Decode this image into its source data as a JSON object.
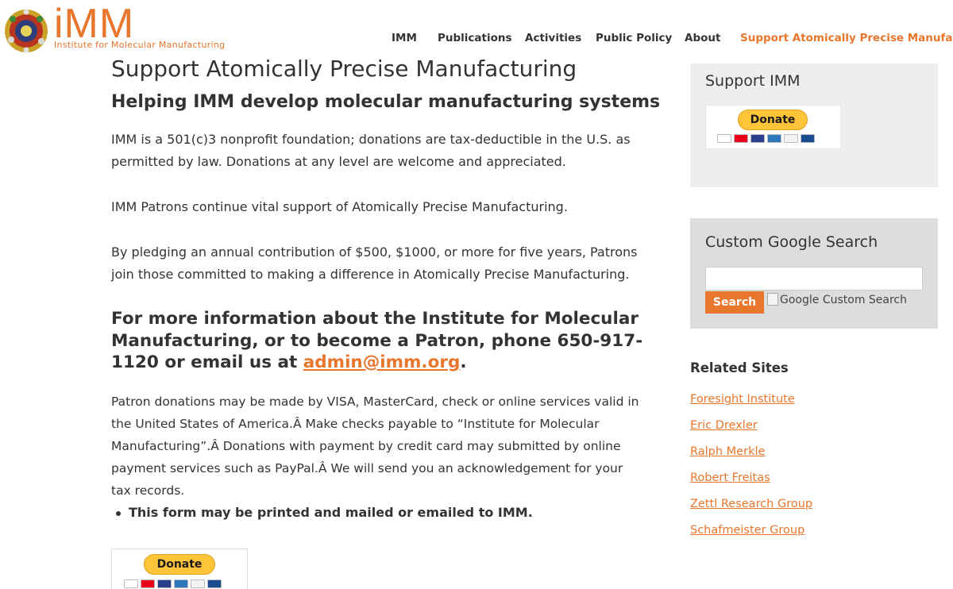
{
  "header": {
    "logo_text": "iMM",
    "logo_sub": "Institute for Molecular Manufacturing"
  },
  "nav": [
    {
      "label": "IMM",
      "active": false
    },
    {
      "label": "Publications",
      "active": false
    },
    {
      "label": "Activities",
      "active": false
    },
    {
      "label": "Public Policy",
      "active": false
    },
    {
      "label": "About",
      "active": false
    },
    {
      "label": "Support Atomically Precise Manufacturing",
      "active": true
    }
  ],
  "main": {
    "title": "Support Atomically Precise Manufacturing",
    "subtitle": "Helping IMM develop molecular manufacturing systems",
    "p1": "IMM is a 501(c)3 nonprofit foundation; donations are tax-deductible in the U.S. as permitted by law. Donations at any level are welcome and appreciated.",
    "p2": "IMM Patrons continue vital support of Atomically Precise Manufacturing.",
    "p3": "By pledging an annual contribution of $500, $1000, or more for five years, Patrons join those committed to making a difference in Atomically Precise Manufacturing.",
    "contact_heading": "For more information about the Institute for Molecular Manufacturing, or to become a Patron, phone 650-917-1120 or email us at ",
    "contact_email": "admin@imm.org",
    "contact_end": ".",
    "p4": "Patron donations may be made by VISA, MasterCard, check or online services valid in the United States of America.Â  Make checks payable to “Institute for Molecular Manufacturing”.Â Donations with payment by credit card may submitted by online payment services such as PayPal.Â  We will send you an acknowledgement for your tax records.",
    "bullet": "This form may be printed and mailed or emailed to IMM.",
    "donate_label": "Donate"
  },
  "sidebar": {
    "support_title": "Support IMM",
    "donate_label": "Donate",
    "search_title": "Custom Google Search",
    "search_button": "Search",
    "search_alt": "Google Custom Search",
    "related_title": "Related Sites",
    "related": [
      "Foresight Institute",
      "Eric Drexler",
      "Ralph Merkle",
      "Robert Freitas",
      "Zettl Research Group",
      "Schafmeister Group"
    ]
  },
  "colors": {
    "accent": "#e8762c",
    "paypal_button": "#ffc439"
  }
}
